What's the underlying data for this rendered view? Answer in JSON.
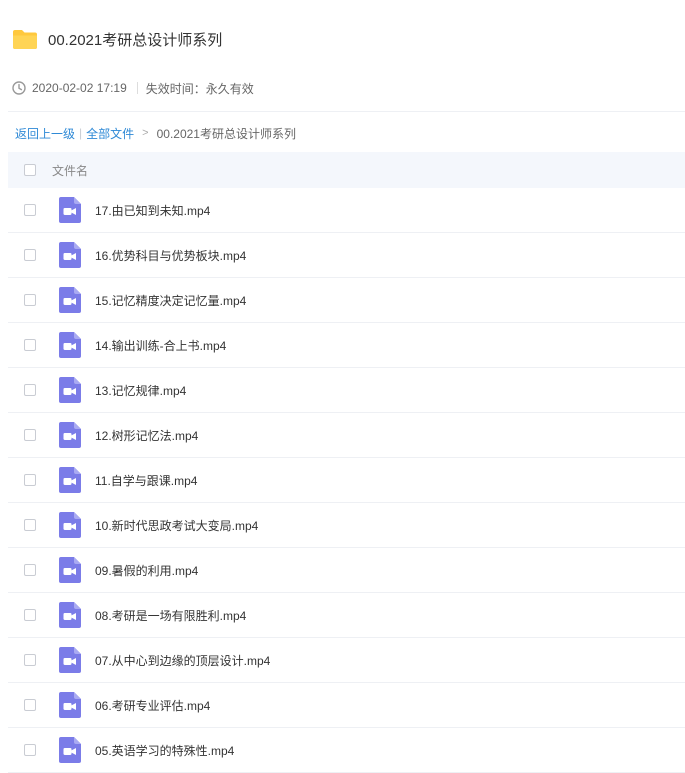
{
  "header": {
    "title": "00.2021考研总设计师系列",
    "date": "2020-02-02 17:19",
    "expiry": "失效时间：永久有效",
    "folder_icon": "folder-icon",
    "clock_icon": "clock-icon"
  },
  "breadcrumb": {
    "back": "返回上一级",
    "all_files": "全部文件",
    "current": "00.2021考研总设计师系列"
  },
  "list": {
    "header_label": "文件名",
    "file_icon": "video-file-icon",
    "files": [
      "17.由已知到未知.mp4",
      "16.优势科目与优势板块.mp4",
      "15.记忆精度决定记忆量.mp4",
      "14.输出训练-合上书.mp4",
      "13.记忆规律.mp4",
      "12.树形记忆法.mp4",
      "11.自学与跟课.mp4",
      "10.新时代思政考试大变局.mp4",
      "09.暑假的利用.mp4",
      "08.考研是一场有限胜利.mp4",
      "07.从中心到边缘的顶层设计.mp4",
      "06.考研专业评估.mp4",
      "05.英语学习的特殊性.mp4"
    ]
  },
  "colors": {
    "folder": "#FFC83D",
    "video_icon": "#7B7CE8",
    "link": "#2E89D6",
    "header_bg": "#F4F7FC"
  }
}
